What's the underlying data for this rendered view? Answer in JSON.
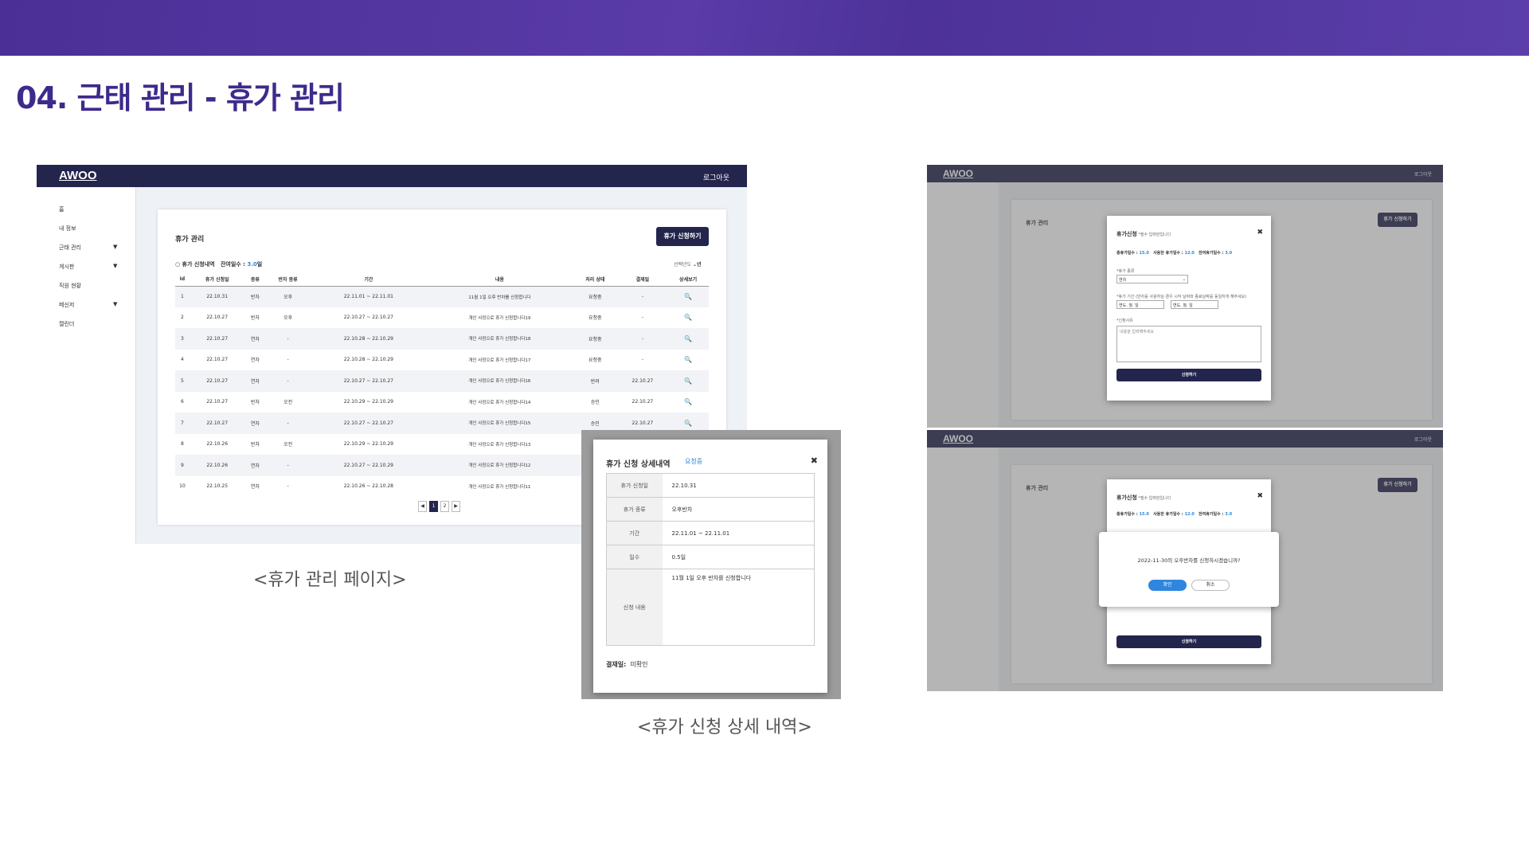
{
  "slide": {
    "title": "04. 근태 관리 - 휴가 관리",
    "caption_left": "<휴가 관리 페이지>",
    "caption_right": "<휴가 신청 상세 내역>"
  },
  "app": {
    "logo": "AWOO",
    "logout": "로그아웃"
  },
  "sidebar": [
    "홈",
    "내 정보",
    "근태 관리",
    "게시판",
    "직원 현황",
    "메신저",
    "캘린더"
  ],
  "sidebar_arrow": "▼",
  "leave_page": {
    "title": "휴가 관리",
    "apply_button": "휴가 신청하기",
    "history_label": "휴가 신청내역",
    "remaining_label": "잔여일수 :",
    "remaining_value": "3.0",
    "remaining_unit": "일",
    "year_filter": "선택년도",
    "year_unit": "년",
    "columns": [
      "Id",
      "휴가 신청일",
      "종류",
      "반차 종류",
      "기간",
      "내용",
      "처리 상태",
      "결재일",
      "상세보기"
    ],
    "rows": [
      [
        "1",
        "22.10.31",
        "반차",
        "오후",
        "22.11.01 ~ 22.11.01",
        "11월 1일 오후 반차를 신청합니다",
        "요청중",
        "-"
      ],
      [
        "2",
        "22.10.27",
        "반차",
        "오후",
        "22.10.27 ~ 22.10.27",
        "개인 사정으로 휴가 신청합니다19",
        "요청중",
        "-"
      ],
      [
        "3",
        "22.10.27",
        "연차",
        "-",
        "22.10.28 ~ 22.10.29",
        "개인 사정으로 휴가 신청합니다18",
        "요청중",
        "-"
      ],
      [
        "4",
        "22.10.27",
        "연차",
        "-",
        "22.10.28 ~ 22.10.29",
        "개인 사정으로 휴가 신청합니다17",
        "요청중",
        "-"
      ],
      [
        "5",
        "22.10.27",
        "연차",
        "-",
        "22.10.27 ~ 22.10.27",
        "개인 사정으로 휴가 신청합니다16",
        "반려",
        "22.10.27"
      ],
      [
        "6",
        "22.10.27",
        "반차",
        "오전",
        "22.10.29 ~ 22.10.29",
        "개인 사정으로 휴가 신청합니다14",
        "승인",
        "22.10.27"
      ],
      [
        "7",
        "22.10.27",
        "연차",
        "-",
        "22.10.27 ~ 22.10.27",
        "개인 사정으로 휴가 신청합니다15",
        "승인",
        "22.10.27"
      ],
      [
        "8",
        "22.10.26",
        "반차",
        "오전",
        "22.10.29 ~ 22.10.29",
        "개인 사정으로 휴가 신청합니다13",
        "",
        ""
      ],
      [
        "9",
        "22.10.26",
        "연차",
        "-",
        "22.10.27 ~ 22.10.29",
        "개인 사정으로 휴가 신청합니다12",
        "",
        ""
      ],
      [
        "10",
        "22.10.25",
        "연차",
        "-",
        "22.10.26 ~ 22.10.28",
        "개인 사정으로 휴가 신청합니다11",
        "",
        ""
      ]
    ],
    "pages": [
      "1",
      "2"
    ],
    "prev": "◀",
    "next": "▶"
  },
  "detail_modal": {
    "title": "휴가 신청 상세내역",
    "status": "요청중",
    "close": "✖",
    "labels": [
      "휴가 신청일",
      "휴가 종류",
      "기간",
      "일수",
      "신청 내용"
    ],
    "values": [
      "22.10.31",
      "오후반차",
      "22.11.01 ~ 22.11.01",
      "0.5일",
      "11월 1일 오후 반차를 신청합니다"
    ],
    "approval_label": "결재일:",
    "approval_value": "미확인"
  },
  "apply_modal": {
    "title": "휴가신청",
    "required_note": "*필수 입력란입니다",
    "total_label": "총휴가일수 :",
    "total_value": "15.0",
    "used_label": "사용한 휴가일수 :",
    "used_value": "12.0",
    "remain_label": "잔여휴가일수 :",
    "remain_value": "3.0",
    "type_label": "*휴가 종류",
    "type_value": "연차",
    "period_label": "*휴가 기간 (반차를 사용하실 경우 시작 날짜와 종료날짜를 동일하게 해주세요)",
    "date_placeholder": "연도. 월. 일",
    "reason_label": "*신청사유",
    "reason_placeholder": "내용을 입력해주세요",
    "submit": "신청하기"
  },
  "confirm_modal": {
    "message": "2022-11-30의 오후반차를 신청하시겠습니까?",
    "ok": "확인",
    "cancel": "취소"
  }
}
